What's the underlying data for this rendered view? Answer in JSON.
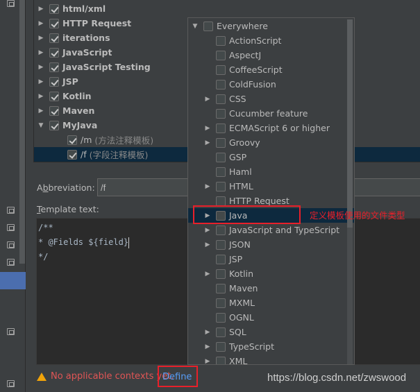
{
  "tree": [
    {
      "label": "html/xml",
      "checked": true,
      "expandable": true
    },
    {
      "label": "HTTP Request",
      "checked": true,
      "expandable": true
    },
    {
      "label": "iterations",
      "checked": true,
      "expandable": true
    },
    {
      "label": "JavaScript",
      "checked": true,
      "expandable": true
    },
    {
      "label": "JavaScript Testing",
      "checked": true,
      "expandable": true
    },
    {
      "label": "JSP",
      "checked": true,
      "expandable": true
    },
    {
      "label": "Kotlin",
      "checked": true,
      "expandable": true
    },
    {
      "label": "Maven",
      "checked": true,
      "expandable": true
    },
    {
      "label": "MyJava",
      "checked": true,
      "expanded": true
    },
    {
      "label": "/m",
      "desc": "(方法注释模板)",
      "checked": true,
      "child": true
    },
    {
      "label": "/f",
      "desc": "(字段注释模板)",
      "checked": true,
      "child": true,
      "selected": true
    }
  ],
  "abbreviation": {
    "label_pre": "A",
    "label_u": "b",
    "label_post": "breviation:",
    "value": "/f"
  },
  "template": {
    "label_u": "T",
    "label_post": "emplate text:",
    "lines": [
      "/**",
      "* @Fields ${field}",
      "*/"
    ]
  },
  "warning": {
    "text": "No applicable contexts yet.",
    "define": "Define"
  },
  "contexts": [
    {
      "label": "Everywhere",
      "arrow": "down",
      "level": 0
    },
    {
      "label": "ActionScript",
      "level": 1
    },
    {
      "label": "AspectJ",
      "level": 1
    },
    {
      "label": "CoffeeScript",
      "level": 1
    },
    {
      "label": "ColdFusion",
      "level": 1
    },
    {
      "label": "CSS",
      "level": 1,
      "arrow": "right"
    },
    {
      "label": "Cucumber feature",
      "level": 1
    },
    {
      "label": "ECMAScript 6 or higher",
      "level": 1,
      "arrow": "right"
    },
    {
      "label": "Groovy",
      "level": 1,
      "arrow": "right"
    },
    {
      "label": "GSP",
      "level": 1
    },
    {
      "label": "Haml",
      "level": 1
    },
    {
      "label": "HTML",
      "level": 1,
      "arrow": "right"
    },
    {
      "label": "HTTP Request",
      "level": 1
    },
    {
      "label": "Java",
      "level": 1,
      "arrow": "right",
      "selected": true
    },
    {
      "label": "JavaScript and TypeScript",
      "level": 1,
      "arrow": "right"
    },
    {
      "label": "JSON",
      "level": 1,
      "arrow": "right"
    },
    {
      "label": "JSP",
      "level": 1
    },
    {
      "label": "Kotlin",
      "level": 1,
      "arrow": "right"
    },
    {
      "label": "Maven",
      "level": 1
    },
    {
      "label": "MXML",
      "level": 1
    },
    {
      "label": "OGNL",
      "level": 1
    },
    {
      "label": "SQL",
      "level": 1,
      "arrow": "right"
    },
    {
      "label": "TypeScript",
      "level": 1,
      "arrow": "right"
    },
    {
      "label": "XML",
      "level": 1,
      "arrow": "right"
    }
  ],
  "annotation": "定义模板使用的文件类型",
  "watermark": "https://blog.csdn.net/zwswood",
  "colors": {
    "background": "#3c3f41",
    "selection": "#0d293e",
    "annotation": "#e8202a",
    "link": "#589df6",
    "warning": "#e05555"
  }
}
